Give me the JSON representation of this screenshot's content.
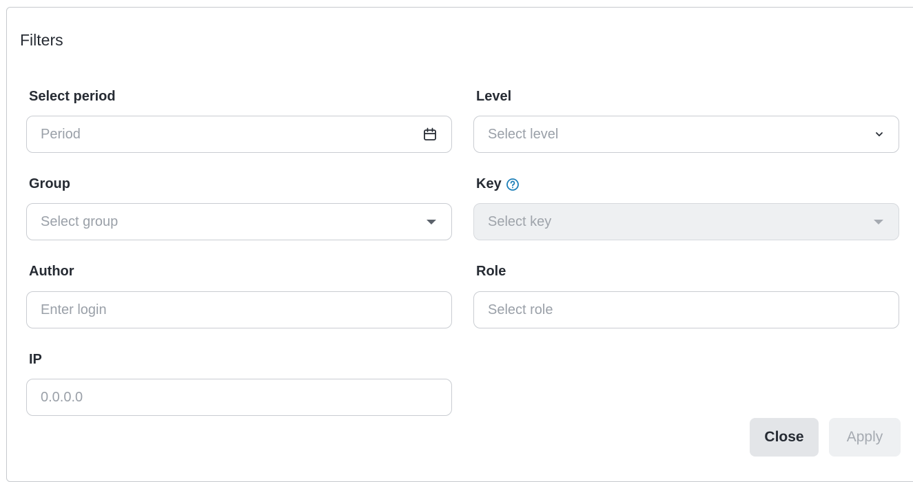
{
  "dialog": {
    "title": "Filters",
    "fields": {
      "period": {
        "label": "Select period",
        "placeholder": "Period",
        "icon": "calendar-icon"
      },
      "level": {
        "label": "Level",
        "placeholder": "Select level",
        "icon": "chevron-down-icon"
      },
      "group": {
        "label": "Group",
        "placeholder": "Select group",
        "icon": "caret-down-icon"
      },
      "key": {
        "label": "Key",
        "placeholder": "Select key",
        "icon": "caret-down-icon",
        "help_icon": "help-circle-icon",
        "disabled": true
      },
      "author": {
        "label": "Author",
        "placeholder": "Enter login"
      },
      "role": {
        "label": "Role",
        "placeholder": "Select role"
      },
      "ip": {
        "label": "IP",
        "placeholder": "0.0.0.0"
      }
    },
    "buttons": {
      "close": "Close",
      "apply": "Apply"
    },
    "colors": {
      "accent": "#1d7fb8",
      "text": "#262b33",
      "placeholder": "#9aa0a8",
      "border": "#c9ccd1",
      "disabled_bg": "#eef0f2"
    }
  }
}
